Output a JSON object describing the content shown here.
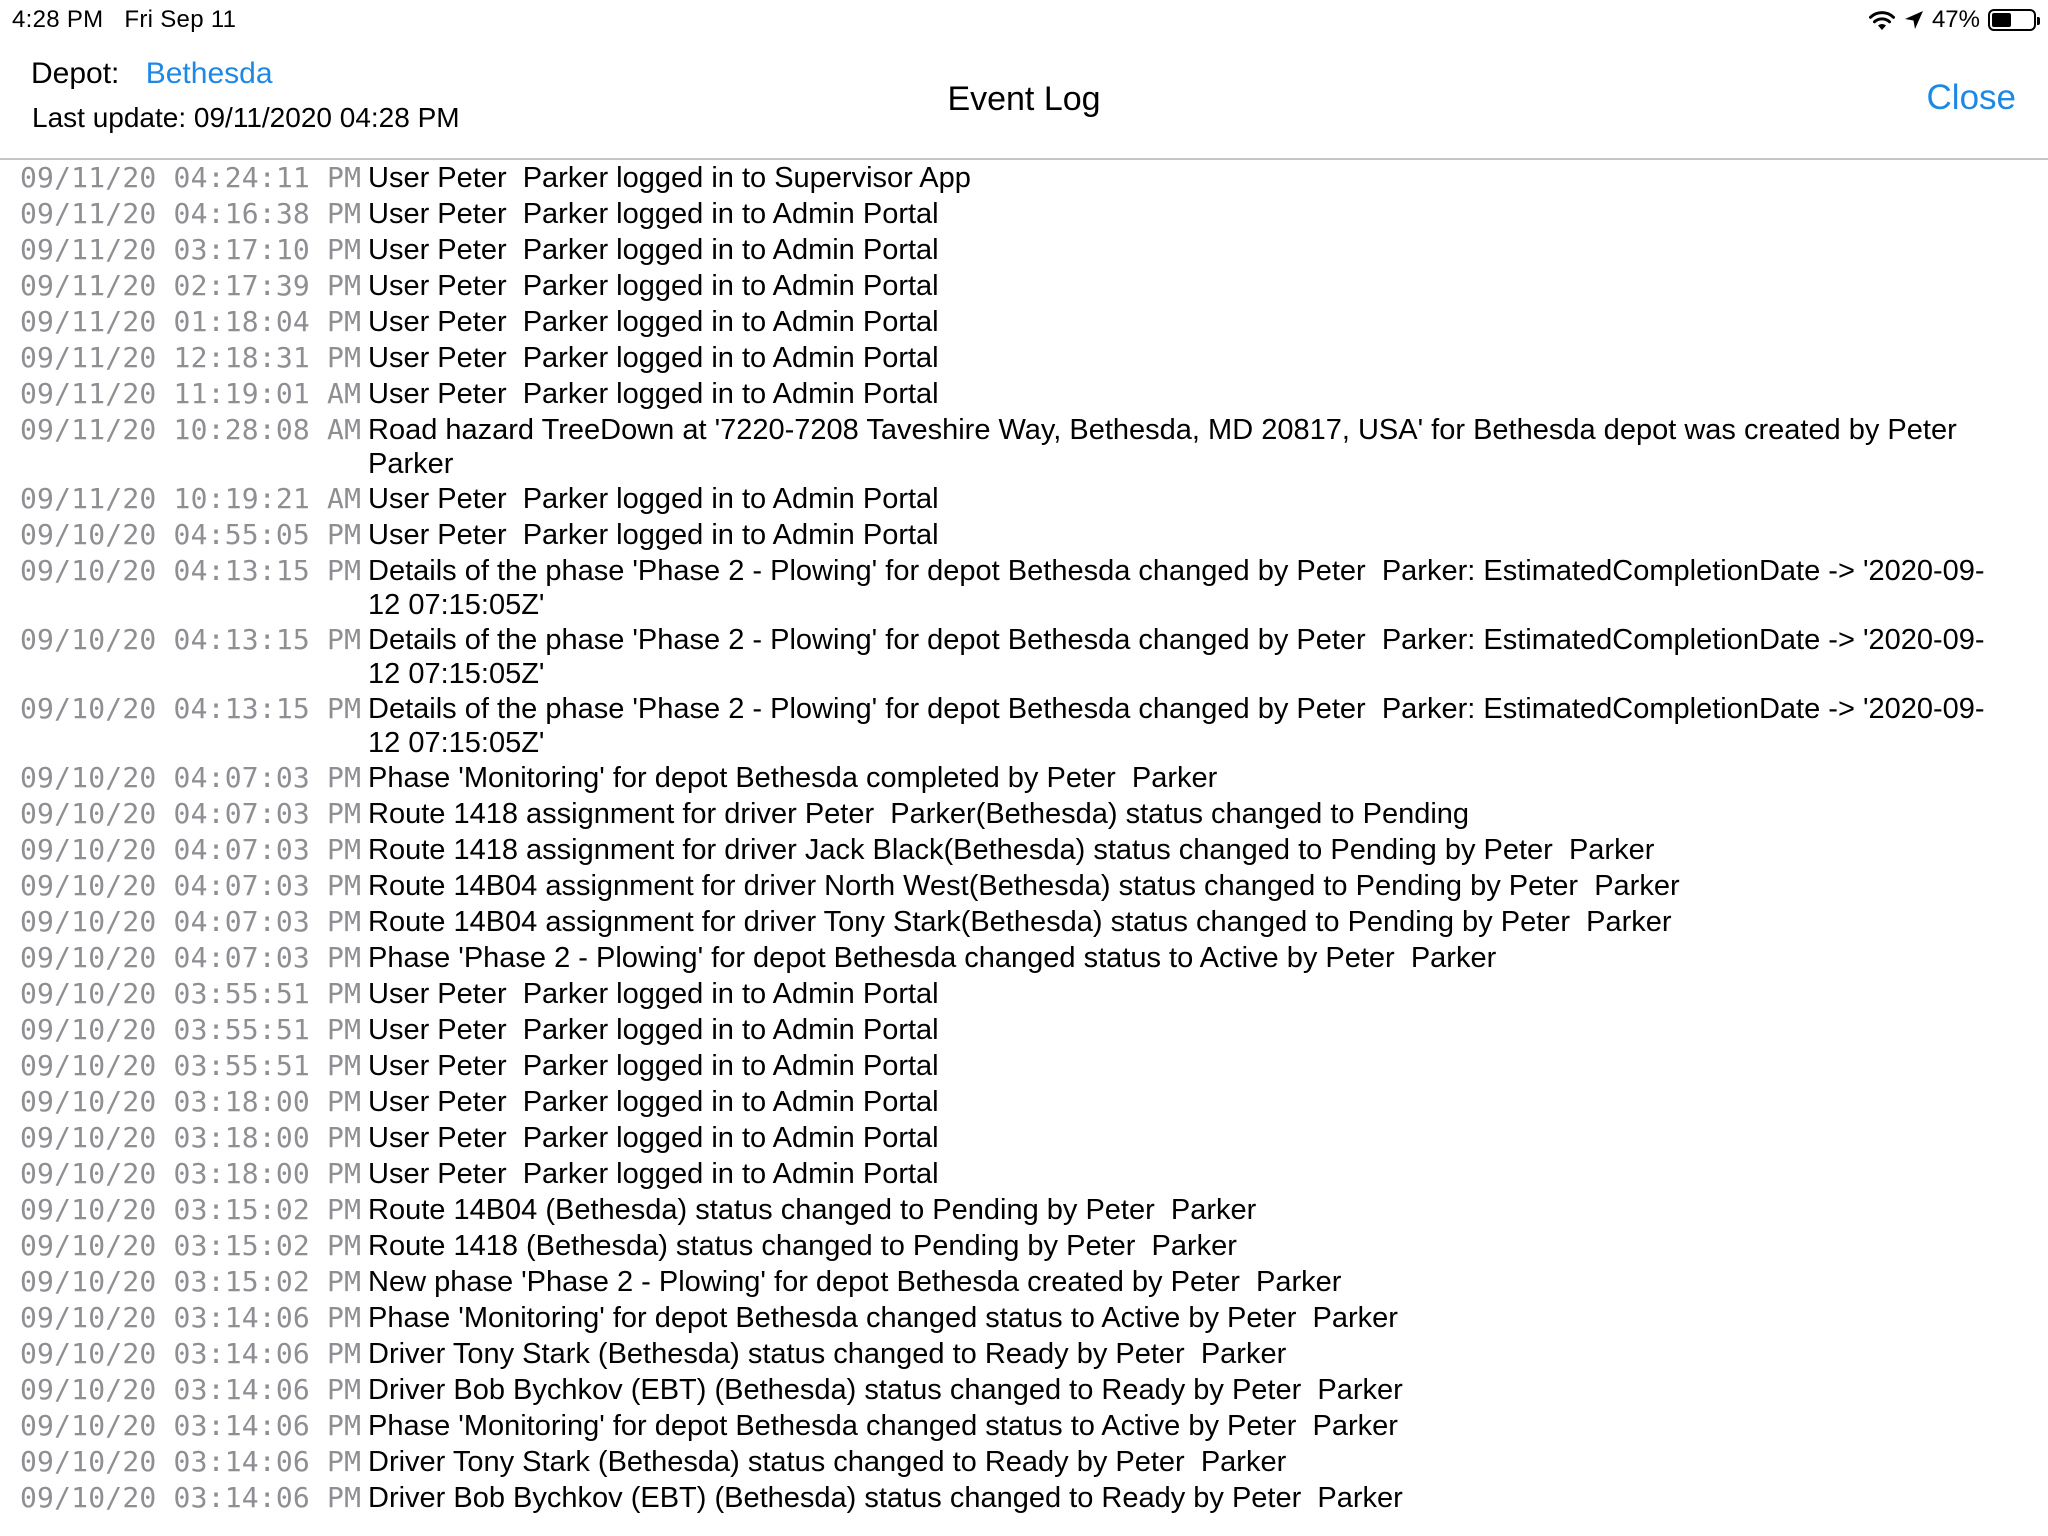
{
  "status_bar": {
    "time": "4:28 PM",
    "date": "Fri Sep 11",
    "battery_percent": "47%",
    "battery_level": 0.47,
    "icons": [
      "wifi-icon",
      "location-arrow-icon",
      "battery-icon"
    ]
  },
  "header": {
    "depot_label": "Depot:",
    "depot_value": "Bethesda",
    "last_update": "Last update: 09/11/2020 04:28 PM",
    "title": "Event Log",
    "close_label": "Close"
  },
  "colors": {
    "accent": "#1e88e5",
    "timestamp": "#8e8e93",
    "separator": "#c6c6c8"
  },
  "events": [
    {
      "time": "09/11/20 04:24:11 PM",
      "text": "User Peter  Parker logged in to Supervisor App"
    },
    {
      "time": "09/11/20 04:16:38 PM",
      "text": "User Peter  Parker logged in to Admin Portal"
    },
    {
      "time": "09/11/20 03:17:10 PM",
      "text": "User Peter  Parker logged in to Admin Portal"
    },
    {
      "time": "09/11/20 02:17:39 PM",
      "text": "User Peter  Parker logged in to Admin Portal"
    },
    {
      "time": "09/11/20 01:18:04 PM",
      "text": "User Peter  Parker logged in to Admin Portal"
    },
    {
      "time": "09/11/20 12:18:31 PM",
      "text": "User Peter  Parker logged in to Admin Portal"
    },
    {
      "time": "09/11/20 11:19:01 AM",
      "text": "User Peter  Parker logged in to Admin Portal"
    },
    {
      "time": "09/11/20 10:28:08 AM",
      "text": "Road hazard TreeDown at '7220-7208 Taveshire Way, Bethesda, MD 20817, USA' for Bethesda depot was created by Peter  Parker"
    },
    {
      "time": "09/11/20 10:19:21 AM",
      "text": "User Peter  Parker logged in to Admin Portal"
    },
    {
      "time": "09/10/20 04:55:05 PM",
      "text": "User Peter  Parker logged in to Admin Portal"
    },
    {
      "time": "09/10/20 04:13:15 PM",
      "text": "Details of the phase 'Phase 2 - Plowing' for depot Bethesda changed by Peter  Parker: EstimatedCompletionDate -> '2020-09-12 07:15:05Z'"
    },
    {
      "time": "09/10/20 04:13:15 PM",
      "text": "Details of the phase 'Phase 2 - Plowing' for depot Bethesda changed by Peter  Parker: EstimatedCompletionDate -> '2020-09-12 07:15:05Z'"
    },
    {
      "time": "09/10/20 04:13:15 PM",
      "text": "Details of the phase 'Phase 2 - Plowing' for depot Bethesda changed by Peter  Parker: EstimatedCompletionDate -> '2020-09-12 07:15:05Z'"
    },
    {
      "time": "09/10/20 04:07:03 PM",
      "text": "Phase 'Monitoring' for depot Bethesda completed by Peter  Parker"
    },
    {
      "time": "09/10/20 04:07:03 PM",
      "text": "Route 1418 assignment for driver Peter  Parker(Bethesda) status changed to Pending"
    },
    {
      "time": "09/10/20 04:07:03 PM",
      "text": "Route 1418 assignment for driver Jack Black(Bethesda) status changed to Pending by Peter  Parker"
    },
    {
      "time": "09/10/20 04:07:03 PM",
      "text": "Route 14B04 assignment for driver North West(Bethesda) status changed to Pending by Peter  Parker"
    },
    {
      "time": "09/10/20 04:07:03 PM",
      "text": "Route 14B04 assignment for driver Tony Stark(Bethesda) status changed to Pending by Peter  Parker"
    },
    {
      "time": "09/10/20 04:07:03 PM",
      "text": "Phase 'Phase 2 - Plowing' for depot Bethesda changed status to Active by Peter  Parker"
    },
    {
      "time": "09/10/20 03:55:51 PM",
      "text": "User Peter  Parker logged in to Admin Portal"
    },
    {
      "time": "09/10/20 03:55:51 PM",
      "text": "User Peter  Parker logged in to Admin Portal"
    },
    {
      "time": "09/10/20 03:55:51 PM",
      "text": "User Peter  Parker logged in to Admin Portal"
    },
    {
      "time": "09/10/20 03:18:00 PM",
      "text": "User Peter  Parker logged in to Admin Portal"
    },
    {
      "time": "09/10/20 03:18:00 PM",
      "text": "User Peter  Parker logged in to Admin Portal"
    },
    {
      "time": "09/10/20 03:18:00 PM",
      "text": "User Peter  Parker logged in to Admin Portal"
    },
    {
      "time": "09/10/20 03:15:02 PM",
      "text": "Route 14B04 (Bethesda) status changed to Pending by Peter  Parker"
    },
    {
      "time": "09/10/20 03:15:02 PM",
      "text": "Route 1418 (Bethesda) status changed to Pending by Peter  Parker"
    },
    {
      "time": "09/10/20 03:15:02 PM",
      "text": "New phase 'Phase 2 - Plowing' for depot Bethesda created by Peter  Parker"
    },
    {
      "time": "09/10/20 03:14:06 PM",
      "text": "Phase 'Monitoring' for depot Bethesda changed status to Active by Peter  Parker"
    },
    {
      "time": "09/10/20 03:14:06 PM",
      "text": "Driver Tony Stark (Bethesda) status changed to Ready by Peter  Parker"
    },
    {
      "time": "09/10/20 03:14:06 PM",
      "text": "Driver Bob Bychkov (EBT) (Bethesda) status changed to Ready by Peter  Parker"
    },
    {
      "time": "09/10/20 03:14:06 PM",
      "text": "Phase 'Monitoring' for depot Bethesda changed status to Active by Peter  Parker"
    },
    {
      "time": "09/10/20 03:14:06 PM",
      "text": "Driver Tony Stark (Bethesda) status changed to Ready by Peter  Parker"
    },
    {
      "time": "09/10/20 03:14:06 PM",
      "text": "Driver Bob Bychkov (EBT) (Bethesda) status changed to Ready by Peter  Parker"
    }
  ]
}
